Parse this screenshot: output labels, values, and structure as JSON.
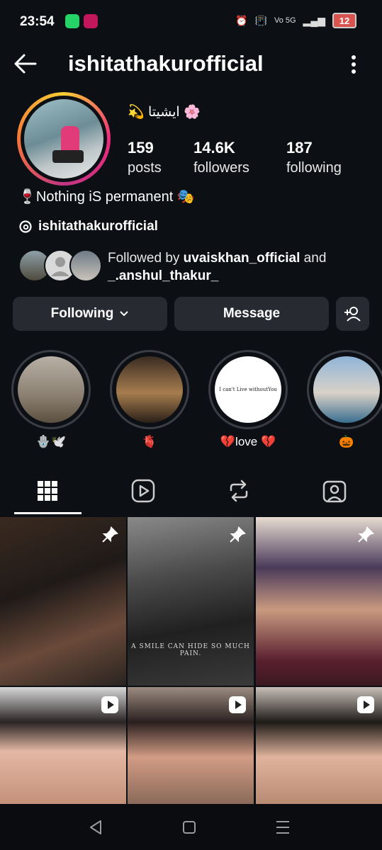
{
  "status": {
    "time": "23:54",
    "battery": "12",
    "net": "Vo 5G"
  },
  "header": {
    "username": "ishitathakurofficial"
  },
  "profile": {
    "display_name": "💫 ایشیتا 🌸",
    "stats": [
      {
        "count": "159",
        "label": "posts"
      },
      {
        "count": "14.6K",
        "label": "followers"
      },
      {
        "count": "187",
        "label": "following"
      }
    ],
    "bio": "🍷Nothing iS permanent 🎭",
    "threads_handle": "ishitathakurofficial",
    "followed_by_prefix": "Followed by ",
    "followed_by_user1": "uvaiskhan_official",
    "followed_by_and": " and",
    "followed_by_user2": "_.anshul_thakur_"
  },
  "actions": {
    "following_label": "Following",
    "message_label": "Message"
  },
  "highlights": [
    {
      "caption": "🪬🕊️"
    },
    {
      "caption": "🫀"
    },
    {
      "caption": "💔love 💔",
      "inner_text": "I can't Live withoutYou"
    },
    {
      "caption": "🎃"
    }
  ],
  "grid_caption": "A SMILE CAN HIDE SO MUCH PAIN.",
  "colors": {
    "background": "#0c0f14",
    "button": "#272a31",
    "accent": "#ee2a7b"
  }
}
